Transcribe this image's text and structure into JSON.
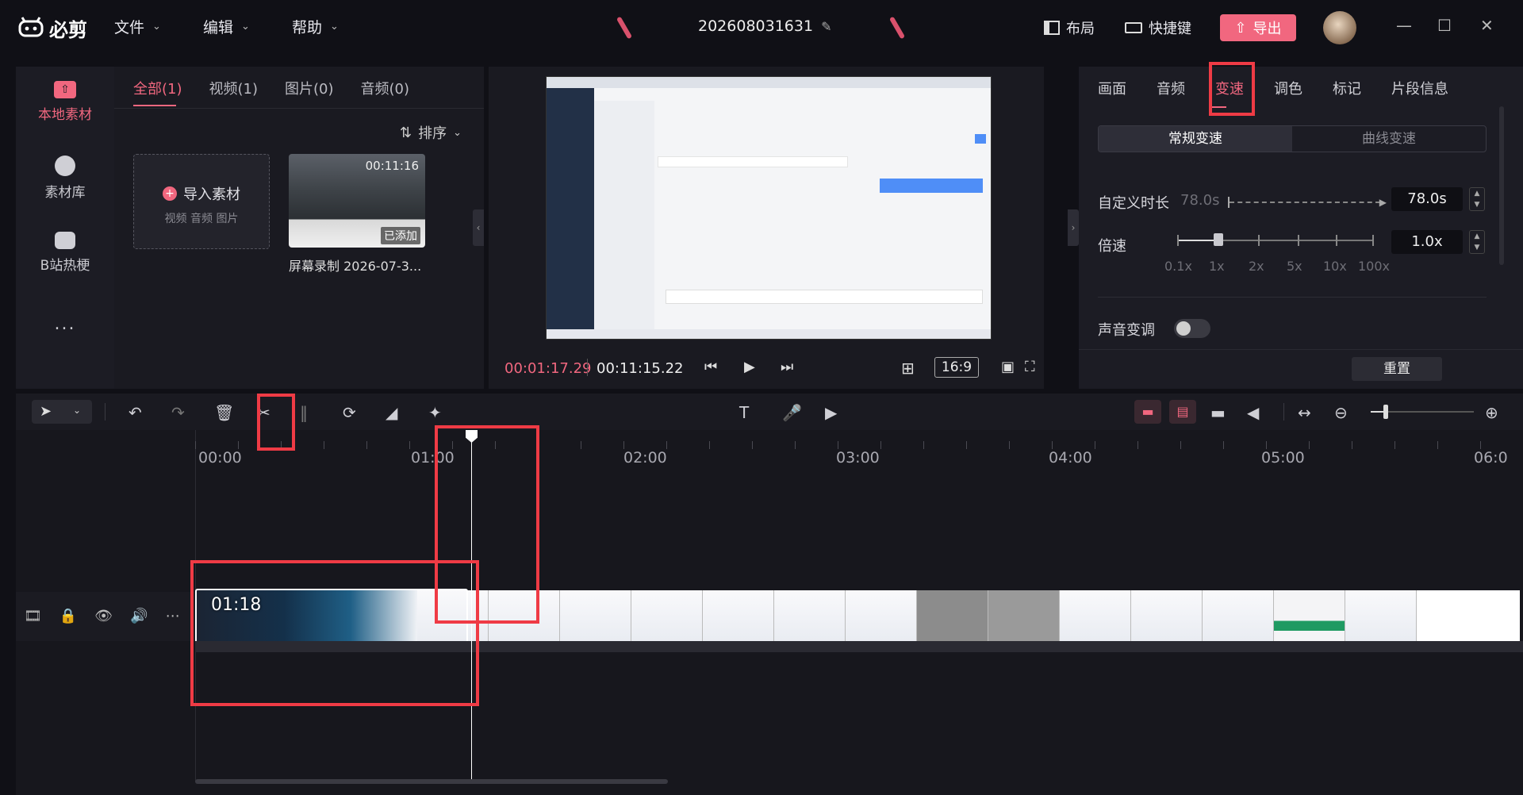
{
  "app": {
    "name": "必剪",
    "project_title": "202608031631"
  },
  "menu": [
    {
      "label": "文件"
    },
    {
      "label": "编辑"
    },
    {
      "label": "帮助"
    }
  ],
  "titlebar_right": {
    "layout_label": "布局",
    "shortcut_label": "快捷键",
    "export_label": "导出"
  },
  "left_nav": [
    {
      "label": "本地素材",
      "active": true
    },
    {
      "label": "素材库"
    },
    {
      "label": "B站热梗"
    },
    {
      "label": "..."
    }
  ],
  "media": {
    "tabs": [
      "全部(1)",
      "视频(1)",
      "图片(0)",
      "音频(0)"
    ],
    "active_tab": 0,
    "sort_label": "排序",
    "import": {
      "title": "导入素材",
      "subtitle": "视频 音频 图片"
    },
    "clip": {
      "duration": "00:11:16",
      "added_badge": "已添加",
      "name": "屏幕录制 2026-07-3..."
    }
  },
  "preview": {
    "current_time": "00:01:17.29",
    "total_time": "00:11:15.22",
    "aspect": "16:9"
  },
  "props": {
    "tabs": [
      "画面",
      "音频",
      "变速",
      "调色",
      "标记",
      "片段信息"
    ],
    "active_tab": 2,
    "speed_modes": [
      "常规变速",
      "曲线变速"
    ],
    "custom_duration_label": "自定义时长",
    "custom_duration_hint": "78.0s",
    "custom_duration_value": "78.0s",
    "speed_label": "倍速",
    "speed_value": "1.0x",
    "speed_scale": [
      "0.1x",
      "1x",
      "2x",
      "5x",
      "10x",
      "100x"
    ],
    "pitch_label": "声音变调",
    "reset_label": "重置"
  },
  "timeline": {
    "ruler_labels": [
      "00:00",
      "01:00",
      "02:00",
      "03:00",
      "04:00",
      "05:00",
      "06:0"
    ],
    "clip_time": "01:18"
  },
  "colors": {
    "accent": "#f1677f",
    "highlight": "#ef3b45",
    "bg": "#101016",
    "panel": "#1c1c24"
  }
}
